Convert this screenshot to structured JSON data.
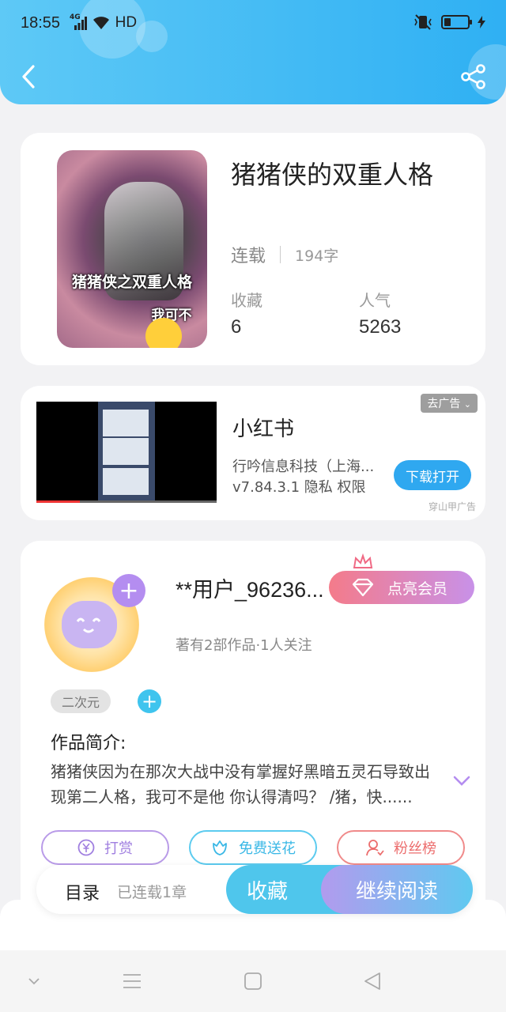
{
  "status_bar": {
    "time": "18:55",
    "network": "4G",
    "hd": "HD"
  },
  "header": {
    "back_icon": "chevron-left-icon",
    "share_icon": "share-icon"
  },
  "book": {
    "title": "猪猪侠的双重人格",
    "cover_text_1": "猪猪侠之双重人格",
    "cover_text_2": "我可不",
    "status": "连载",
    "word_count": "194字",
    "favorites_label": "收藏",
    "favorites_value": "6",
    "popularity_label": "人气",
    "popularity_value": "5263"
  },
  "ad": {
    "app_name": "小红书",
    "company": "行吟信息科技（上海...",
    "version_line": "v7.84.3.1  隐私  权限",
    "close_label": "去广告",
    "download_label": "下载打开",
    "source": "穿山甲广告"
  },
  "author": {
    "name": "**用户_96236...",
    "vip_label": "点亮会员",
    "meta": "著有2部作品·1人关注",
    "tag": "二次元",
    "intro_heading": "作品简介:",
    "intro_text": "猪猪侠因为在那次大战中没有掌握好黑暗五灵石导致出现第二人格，我可不是他 你认得清吗？ /猪，快......"
  },
  "actions": {
    "reward": "打赏",
    "flower": "免费送花",
    "fans": "粉丝榜"
  },
  "bottom_bar": {
    "toc": "目录",
    "chapter_count": "已连载1章",
    "favorite": "收藏",
    "continue_reading": "继续阅读"
  },
  "colors": {
    "header": "#2fb0f3",
    "accent_blue": "#4fc6ec",
    "vip_gradient_start": "#f47b8a",
    "vip_gradient_end": "#c891e8"
  }
}
